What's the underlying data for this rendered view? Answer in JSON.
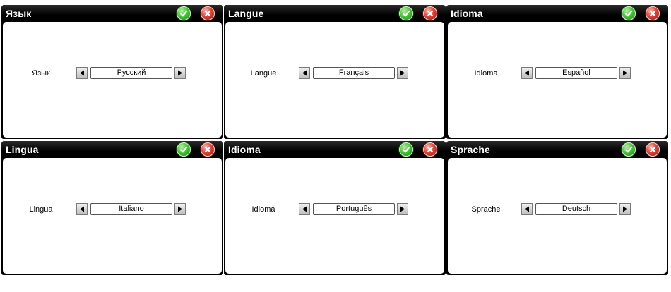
{
  "panels": [
    {
      "title": "Язык",
      "label": "Язык",
      "value": "Русский"
    },
    {
      "title": "Langue",
      "label": "Langue",
      "value": "Français"
    },
    {
      "title": "Idioma",
      "label": "Idioma",
      "value": "Español"
    },
    {
      "title": "Lingua",
      "label": "Lingua",
      "value": "Italiano"
    },
    {
      "title": "Idioma",
      "label": "Idioma",
      "value": "Português"
    },
    {
      "title": "Sprache",
      "label": "Sprache",
      "value": "Deutsch"
    }
  ],
  "icons": {
    "confirm": "check-icon",
    "cancel": "close-icon",
    "prev": "triangle-left-icon",
    "next": "triangle-right-icon"
  },
  "colors": {
    "titlebar": "#000000",
    "confirm": "#3fb832",
    "cancel": "#cf3b31",
    "panel_body": "#ffffff"
  }
}
